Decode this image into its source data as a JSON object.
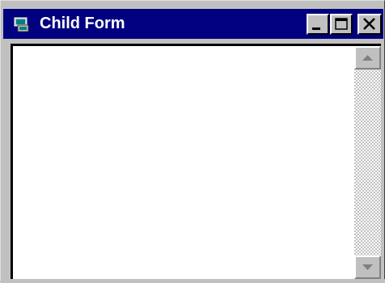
{
  "window": {
    "title": "Child Form",
    "icon": "child-form-app-icon",
    "controls": {
      "minimize_icon": "minimize-icon",
      "maximize_icon": "maximize-icon",
      "close_icon": "close-icon"
    }
  },
  "vertical_scrollbar": {
    "up_icon": "scroll-up-arrow-icon",
    "down_icon": "scroll-down-arrow-icon"
  },
  "colors": {
    "titlebar": "#000080",
    "title_text": "#ffffff",
    "face": "#c0c0c0",
    "client": "#ffffff"
  }
}
